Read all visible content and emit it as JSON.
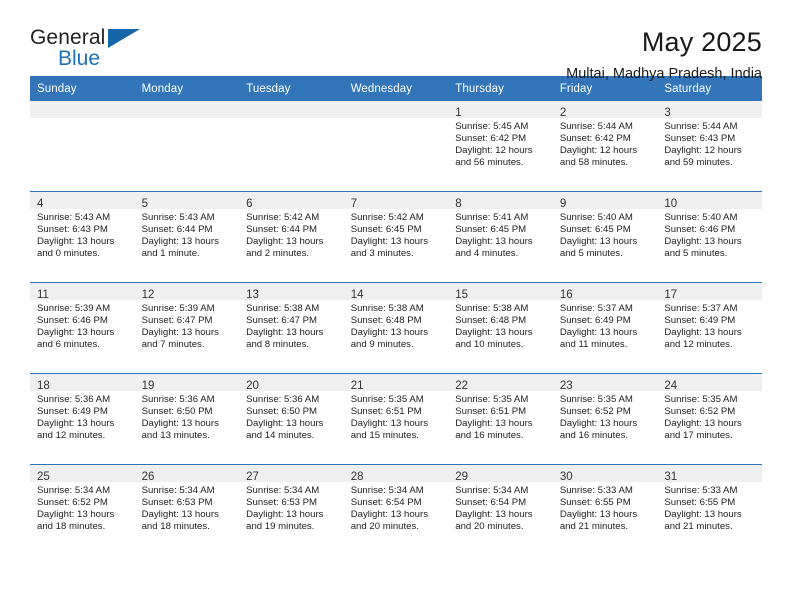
{
  "brand": {
    "name_top": "General",
    "name_bottom": "Blue",
    "accent_color": "#1565a8",
    "icon": "triangle-logo-mark"
  },
  "header": {
    "title": "May 2025",
    "subtitle": "Multai, Madhya Pradesh, India"
  },
  "calendar": {
    "header_bg": "#3275b9",
    "header_text_color": "#ffffff",
    "weekday_headers": [
      "Sunday",
      "Monday",
      "Tuesday",
      "Wednesday",
      "Thursday",
      "Friday",
      "Saturday"
    ],
    "weeks": [
      [
        {
          "day": "",
          "lines": []
        },
        {
          "day": "",
          "lines": []
        },
        {
          "day": "",
          "lines": []
        },
        {
          "day": "",
          "lines": []
        },
        {
          "day": "1",
          "lines": [
            "Sunrise: 5:45 AM",
            "Sunset: 6:42 PM",
            "Daylight: 12 hours",
            "and 56 minutes."
          ]
        },
        {
          "day": "2",
          "lines": [
            "Sunrise: 5:44 AM",
            "Sunset: 6:42 PM",
            "Daylight: 12 hours",
            "and 58 minutes."
          ]
        },
        {
          "day": "3",
          "lines": [
            "Sunrise: 5:44 AM",
            "Sunset: 6:43 PM",
            "Daylight: 12 hours",
            "and 59 minutes."
          ]
        }
      ],
      [
        {
          "day": "4",
          "lines": [
            "Sunrise: 5:43 AM",
            "Sunset: 6:43 PM",
            "Daylight: 13 hours",
            "and 0 minutes."
          ]
        },
        {
          "day": "5",
          "lines": [
            "Sunrise: 5:43 AM",
            "Sunset: 6:44 PM",
            "Daylight: 13 hours",
            "and 1 minute."
          ]
        },
        {
          "day": "6",
          "lines": [
            "Sunrise: 5:42 AM",
            "Sunset: 6:44 PM",
            "Daylight: 13 hours",
            "and 2 minutes."
          ]
        },
        {
          "day": "7",
          "lines": [
            "Sunrise: 5:42 AM",
            "Sunset: 6:45 PM",
            "Daylight: 13 hours",
            "and 3 minutes."
          ]
        },
        {
          "day": "8",
          "lines": [
            "Sunrise: 5:41 AM",
            "Sunset: 6:45 PM",
            "Daylight: 13 hours",
            "and 4 minutes."
          ]
        },
        {
          "day": "9",
          "lines": [
            "Sunrise: 5:40 AM",
            "Sunset: 6:45 PM",
            "Daylight: 13 hours",
            "and 5 minutes."
          ]
        },
        {
          "day": "10",
          "lines": [
            "Sunrise: 5:40 AM",
            "Sunset: 6:46 PM",
            "Daylight: 13 hours",
            "and 5 minutes."
          ]
        }
      ],
      [
        {
          "day": "11",
          "lines": [
            "Sunrise: 5:39 AM",
            "Sunset: 6:46 PM",
            "Daylight: 13 hours",
            "and 6 minutes."
          ]
        },
        {
          "day": "12",
          "lines": [
            "Sunrise: 5:39 AM",
            "Sunset: 6:47 PM",
            "Daylight: 13 hours",
            "and 7 minutes."
          ]
        },
        {
          "day": "13",
          "lines": [
            "Sunrise: 5:38 AM",
            "Sunset: 6:47 PM",
            "Daylight: 13 hours",
            "and 8 minutes."
          ]
        },
        {
          "day": "14",
          "lines": [
            "Sunrise: 5:38 AM",
            "Sunset: 6:48 PM",
            "Daylight: 13 hours",
            "and 9 minutes."
          ]
        },
        {
          "day": "15",
          "lines": [
            "Sunrise: 5:38 AM",
            "Sunset: 6:48 PM",
            "Daylight: 13 hours",
            "and 10 minutes."
          ]
        },
        {
          "day": "16",
          "lines": [
            "Sunrise: 5:37 AM",
            "Sunset: 6:49 PM",
            "Daylight: 13 hours",
            "and 11 minutes."
          ]
        },
        {
          "day": "17",
          "lines": [
            "Sunrise: 5:37 AM",
            "Sunset: 6:49 PM",
            "Daylight: 13 hours",
            "and 12 minutes."
          ]
        }
      ],
      [
        {
          "day": "18",
          "lines": [
            "Sunrise: 5:36 AM",
            "Sunset: 6:49 PM",
            "Daylight: 13 hours",
            "and 12 minutes."
          ]
        },
        {
          "day": "19",
          "lines": [
            "Sunrise: 5:36 AM",
            "Sunset: 6:50 PM",
            "Daylight: 13 hours",
            "and 13 minutes."
          ]
        },
        {
          "day": "20",
          "lines": [
            "Sunrise: 5:36 AM",
            "Sunset: 6:50 PM",
            "Daylight: 13 hours",
            "and 14 minutes."
          ]
        },
        {
          "day": "21",
          "lines": [
            "Sunrise: 5:35 AM",
            "Sunset: 6:51 PM",
            "Daylight: 13 hours",
            "and 15 minutes."
          ]
        },
        {
          "day": "22",
          "lines": [
            "Sunrise: 5:35 AM",
            "Sunset: 6:51 PM",
            "Daylight: 13 hours",
            "and 16 minutes."
          ]
        },
        {
          "day": "23",
          "lines": [
            "Sunrise: 5:35 AM",
            "Sunset: 6:52 PM",
            "Daylight: 13 hours",
            "and 16 minutes."
          ]
        },
        {
          "day": "24",
          "lines": [
            "Sunrise: 5:35 AM",
            "Sunset: 6:52 PM",
            "Daylight: 13 hours",
            "and 17 minutes."
          ]
        }
      ],
      [
        {
          "day": "25",
          "lines": [
            "Sunrise: 5:34 AM",
            "Sunset: 6:52 PM",
            "Daylight: 13 hours",
            "and 18 minutes."
          ]
        },
        {
          "day": "26",
          "lines": [
            "Sunrise: 5:34 AM",
            "Sunset: 6:53 PM",
            "Daylight: 13 hours",
            "and 18 minutes."
          ]
        },
        {
          "day": "27",
          "lines": [
            "Sunrise: 5:34 AM",
            "Sunset: 6:53 PM",
            "Daylight: 13 hours",
            "and 19 minutes."
          ]
        },
        {
          "day": "28",
          "lines": [
            "Sunrise: 5:34 AM",
            "Sunset: 6:54 PM",
            "Daylight: 13 hours",
            "and 20 minutes."
          ]
        },
        {
          "day": "29",
          "lines": [
            "Sunrise: 5:34 AM",
            "Sunset: 6:54 PM",
            "Daylight: 13 hours",
            "and 20 minutes."
          ]
        },
        {
          "day": "30",
          "lines": [
            "Sunrise: 5:33 AM",
            "Sunset: 6:55 PM",
            "Daylight: 13 hours",
            "and 21 minutes."
          ]
        },
        {
          "day": "31",
          "lines": [
            "Sunrise: 5:33 AM",
            "Sunset: 6:55 PM",
            "Daylight: 13 hours",
            "and 21 minutes."
          ]
        }
      ]
    ]
  }
}
